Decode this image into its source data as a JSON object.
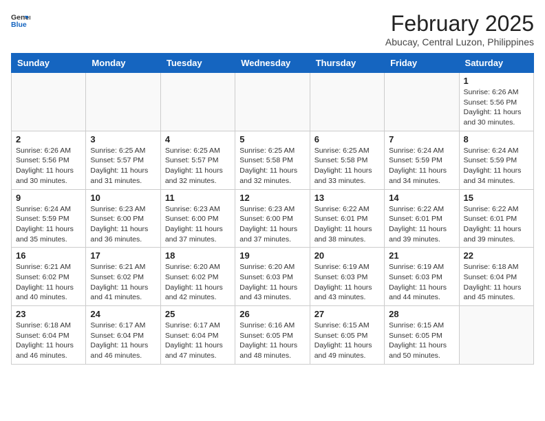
{
  "header": {
    "logo": {
      "general": "General",
      "blue": "Blue"
    },
    "month_year": "February 2025",
    "location": "Abucay, Central Luzon, Philippines"
  },
  "weekdays": [
    "Sunday",
    "Monday",
    "Tuesday",
    "Wednesday",
    "Thursday",
    "Friday",
    "Saturday"
  ],
  "weeks": [
    [
      {
        "day": "",
        "info": ""
      },
      {
        "day": "",
        "info": ""
      },
      {
        "day": "",
        "info": ""
      },
      {
        "day": "",
        "info": ""
      },
      {
        "day": "",
        "info": ""
      },
      {
        "day": "",
        "info": ""
      },
      {
        "day": "1",
        "info": "Sunrise: 6:26 AM\nSunset: 5:56 PM\nDaylight: 11 hours\nand 30 minutes."
      }
    ],
    [
      {
        "day": "2",
        "info": "Sunrise: 6:26 AM\nSunset: 5:56 PM\nDaylight: 11 hours\nand 30 minutes."
      },
      {
        "day": "3",
        "info": "Sunrise: 6:25 AM\nSunset: 5:57 PM\nDaylight: 11 hours\nand 31 minutes."
      },
      {
        "day": "4",
        "info": "Sunrise: 6:25 AM\nSunset: 5:57 PM\nDaylight: 11 hours\nand 32 minutes."
      },
      {
        "day": "5",
        "info": "Sunrise: 6:25 AM\nSunset: 5:58 PM\nDaylight: 11 hours\nand 32 minutes."
      },
      {
        "day": "6",
        "info": "Sunrise: 6:25 AM\nSunset: 5:58 PM\nDaylight: 11 hours\nand 33 minutes."
      },
      {
        "day": "7",
        "info": "Sunrise: 6:24 AM\nSunset: 5:59 PM\nDaylight: 11 hours\nand 34 minutes."
      },
      {
        "day": "8",
        "info": "Sunrise: 6:24 AM\nSunset: 5:59 PM\nDaylight: 11 hours\nand 34 minutes."
      }
    ],
    [
      {
        "day": "9",
        "info": "Sunrise: 6:24 AM\nSunset: 5:59 PM\nDaylight: 11 hours\nand 35 minutes."
      },
      {
        "day": "10",
        "info": "Sunrise: 6:23 AM\nSunset: 6:00 PM\nDaylight: 11 hours\nand 36 minutes."
      },
      {
        "day": "11",
        "info": "Sunrise: 6:23 AM\nSunset: 6:00 PM\nDaylight: 11 hours\nand 37 minutes."
      },
      {
        "day": "12",
        "info": "Sunrise: 6:23 AM\nSunset: 6:00 PM\nDaylight: 11 hours\nand 37 minutes."
      },
      {
        "day": "13",
        "info": "Sunrise: 6:22 AM\nSunset: 6:01 PM\nDaylight: 11 hours\nand 38 minutes."
      },
      {
        "day": "14",
        "info": "Sunrise: 6:22 AM\nSunset: 6:01 PM\nDaylight: 11 hours\nand 39 minutes."
      },
      {
        "day": "15",
        "info": "Sunrise: 6:22 AM\nSunset: 6:01 PM\nDaylight: 11 hours\nand 39 minutes."
      }
    ],
    [
      {
        "day": "16",
        "info": "Sunrise: 6:21 AM\nSunset: 6:02 PM\nDaylight: 11 hours\nand 40 minutes."
      },
      {
        "day": "17",
        "info": "Sunrise: 6:21 AM\nSunset: 6:02 PM\nDaylight: 11 hours\nand 41 minutes."
      },
      {
        "day": "18",
        "info": "Sunrise: 6:20 AM\nSunset: 6:02 PM\nDaylight: 11 hours\nand 42 minutes."
      },
      {
        "day": "19",
        "info": "Sunrise: 6:20 AM\nSunset: 6:03 PM\nDaylight: 11 hours\nand 43 minutes."
      },
      {
        "day": "20",
        "info": "Sunrise: 6:19 AM\nSunset: 6:03 PM\nDaylight: 11 hours\nand 43 minutes."
      },
      {
        "day": "21",
        "info": "Sunrise: 6:19 AM\nSunset: 6:03 PM\nDaylight: 11 hours\nand 44 minutes."
      },
      {
        "day": "22",
        "info": "Sunrise: 6:18 AM\nSunset: 6:04 PM\nDaylight: 11 hours\nand 45 minutes."
      }
    ],
    [
      {
        "day": "23",
        "info": "Sunrise: 6:18 AM\nSunset: 6:04 PM\nDaylight: 11 hours\nand 46 minutes."
      },
      {
        "day": "24",
        "info": "Sunrise: 6:17 AM\nSunset: 6:04 PM\nDaylight: 11 hours\nand 46 minutes."
      },
      {
        "day": "25",
        "info": "Sunrise: 6:17 AM\nSunset: 6:04 PM\nDaylight: 11 hours\nand 47 minutes."
      },
      {
        "day": "26",
        "info": "Sunrise: 6:16 AM\nSunset: 6:05 PM\nDaylight: 11 hours\nand 48 minutes."
      },
      {
        "day": "27",
        "info": "Sunrise: 6:15 AM\nSunset: 6:05 PM\nDaylight: 11 hours\nand 49 minutes."
      },
      {
        "day": "28",
        "info": "Sunrise: 6:15 AM\nSunset: 6:05 PM\nDaylight: 11 hours\nand 50 minutes."
      },
      {
        "day": "",
        "info": ""
      }
    ]
  ]
}
